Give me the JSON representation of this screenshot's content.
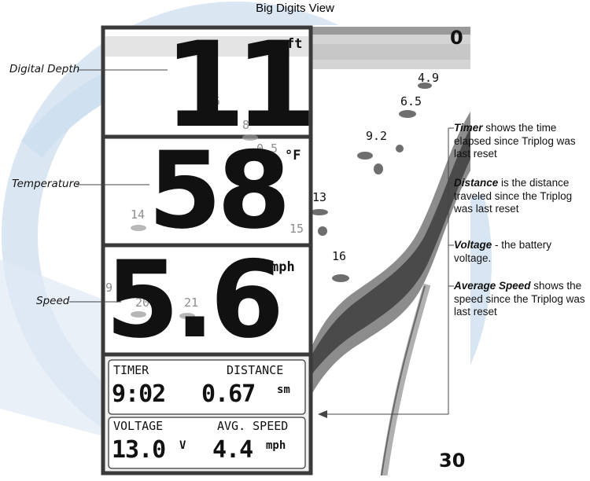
{
  "title": "Big Digits View",
  "left_labels": {
    "digital_depth": "Digital Depth",
    "temperature": "Temperature",
    "speed": "Speed"
  },
  "digits": {
    "depth": "11",
    "depth_unit": "ft",
    "temperature": "58",
    "temperature_unit": "°F",
    "speed": "5.6",
    "speed_unit": "mph"
  },
  "triplog": {
    "timer_label": "TIMER",
    "distance_label": "DISTANCE",
    "timer_value": "9:02",
    "distance_value": "0.67",
    "distance_unit": "sm",
    "voltage_label": "VOLTAGE",
    "avg_speed_label": "AVG. SPEED",
    "voltage_value": "13.0",
    "voltage_unit": "V",
    "avg_speed_value": "4.4",
    "avg_speed_unit": "mph"
  },
  "scale": {
    "top": "0",
    "bottom": "30"
  },
  "fish_marks": [
    {
      "id": "fish-4-9",
      "label": "4.9"
    },
    {
      "id": "fish-6-5-right",
      "label": "6.5"
    },
    {
      "id": "fish-9-2",
      "label": "9.2"
    },
    {
      "id": "fish-13",
      "label": "13"
    },
    {
      "id": "fish-16",
      "label": "16"
    },
    {
      "id": "fish-15",
      "label": "15"
    },
    {
      "id": "fish-6-5-ghost",
      "label": "6.5"
    },
    {
      "id": "fish-8-ghost",
      "label": "8"
    },
    {
      "id": "fish-10-5-ghost",
      "label": "0.5"
    },
    {
      "id": "fish-14-ghost",
      "label": "14"
    },
    {
      "id": "fish-21-ghost",
      "label": "21"
    },
    {
      "id": "fish-9-ghost",
      "label": "9"
    },
    {
      "id": "fish-20-ghost",
      "label": "20"
    }
  ],
  "descriptions": {
    "timer_term": "Timer",
    "timer_text": " shows the time elapsed since Triplog was last reset",
    "distance_term": "Distance",
    "distance_text": " is the distance traveled since the Triplog was last reset",
    "voltage_term": "Voltage",
    "voltage_text": " - the battery voltage.",
    "avg_speed_term": "Average Speed",
    "avg_speed_text": " shows the speed since the Triplog was last reset"
  },
  "colors": {
    "watermark_blue": "#c9dbef",
    "watermark_orange": "#fbe3b8",
    "frame": "#3a3a3a",
    "bottom_contour": "#7a7a7a"
  }
}
